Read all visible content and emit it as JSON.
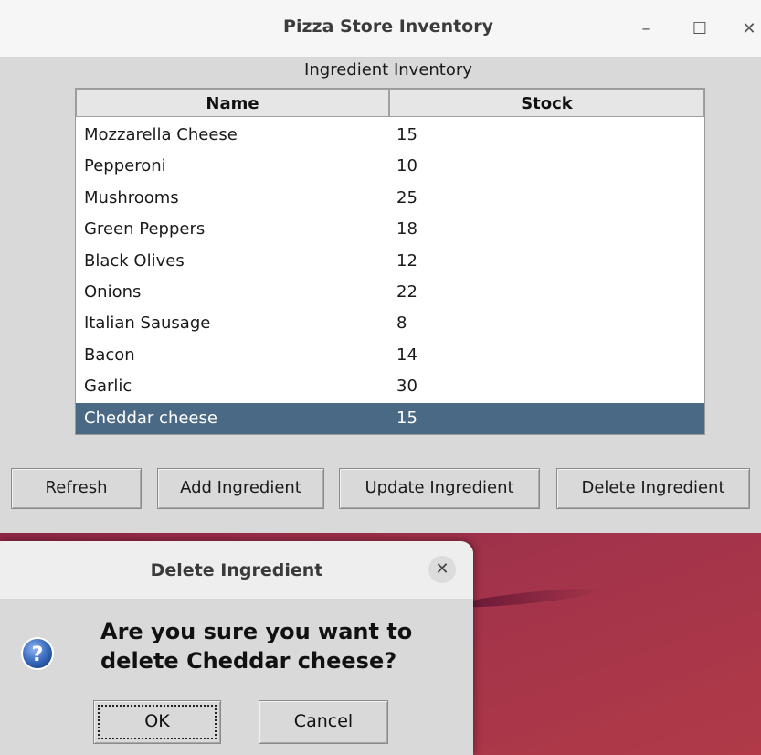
{
  "window": {
    "title": "Pizza Store Inventory",
    "min_glyph": "–",
    "max_glyph": "☐",
    "close_glyph": "✕"
  },
  "inventory": {
    "label": "Ingredient Inventory",
    "columns": [
      "Name",
      "Stock"
    ],
    "rows": [
      {
        "name": "Mozzarella Cheese",
        "stock": "15"
      },
      {
        "name": "Pepperoni",
        "stock": "10"
      },
      {
        "name": "Mushrooms",
        "stock": "25"
      },
      {
        "name": "Green Peppers",
        "stock": "18"
      },
      {
        "name": "Black Olives",
        "stock": "12"
      },
      {
        "name": "Onions",
        "stock": "22"
      },
      {
        "name": "Italian Sausage",
        "stock": "8"
      },
      {
        "name": "Bacon",
        "stock": "14"
      },
      {
        "name": "Garlic",
        "stock": "30"
      },
      {
        "name": "Cheddar cheese",
        "stock": "15"
      }
    ],
    "selected_index": 9
  },
  "buttons": {
    "refresh": "Refresh",
    "add": "Add Ingredient",
    "update": "Update Ingredient",
    "delete": "Delete Ingredient"
  },
  "dialog": {
    "title": "Delete Ingredient",
    "close_glyph": "✕",
    "icon": "question-icon",
    "message_line1": "Are you sure you want to",
    "message_line2": "delete Cheddar cheese?",
    "ok_mnemonic": "O",
    "ok_rest": "K",
    "cancel_mnemonic": "C",
    "cancel_rest": "ancel"
  },
  "colors": {
    "selection": "#4a6984",
    "desktop": "#a8334a",
    "question_icon": "#3d6fc1"
  }
}
